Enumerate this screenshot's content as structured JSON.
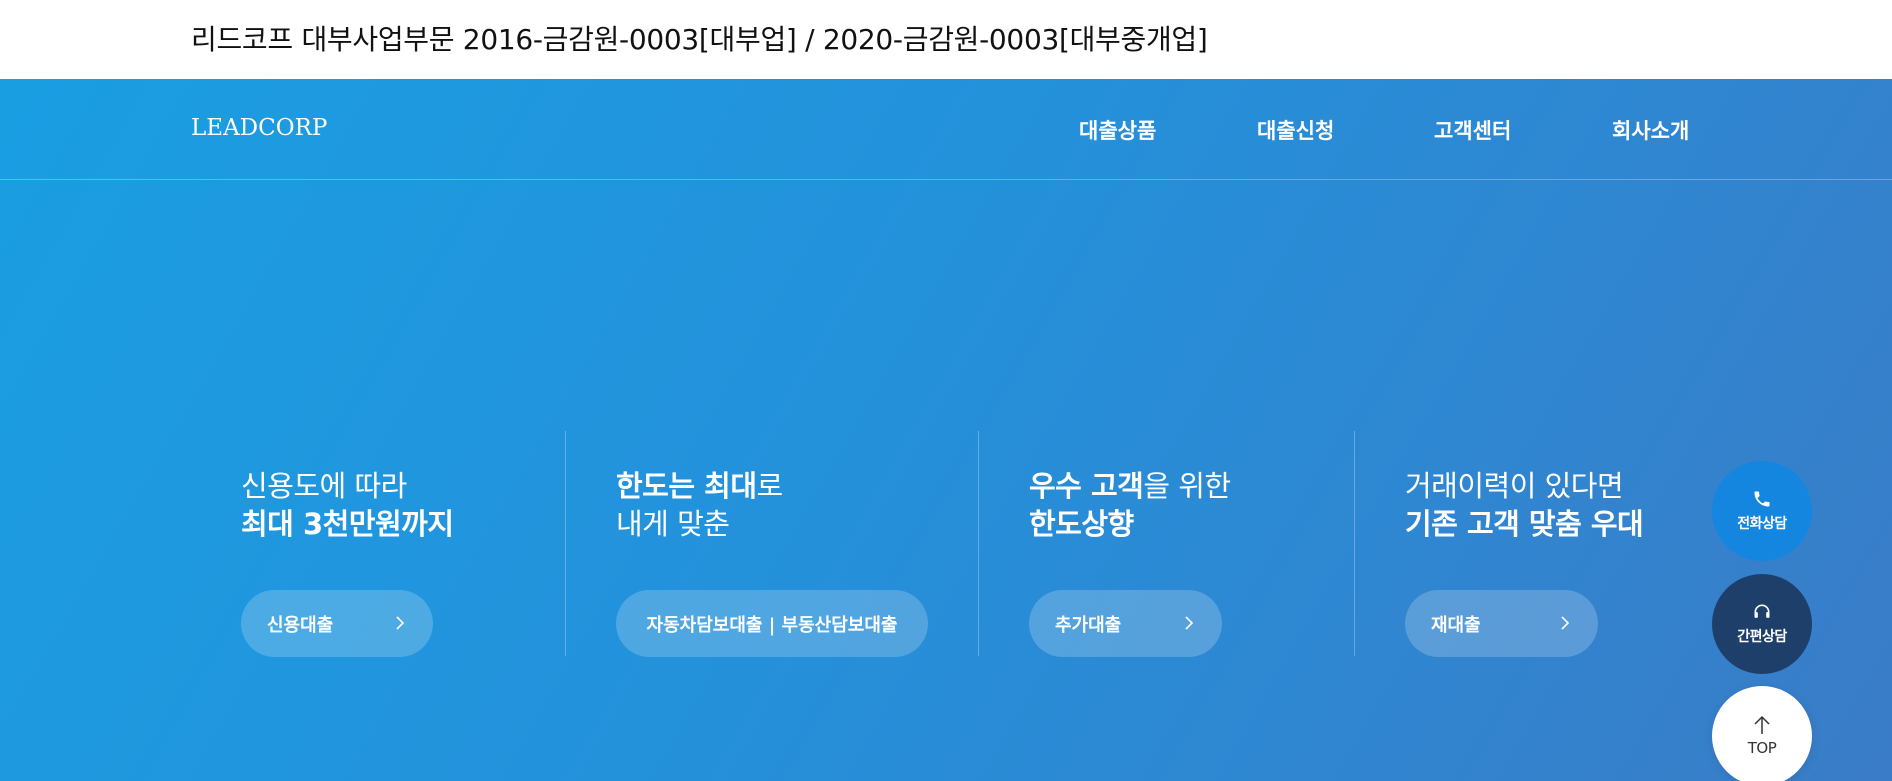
{
  "top_bar": {
    "license_text": "리드코프 대부사업부문 2016-금감원-0003[대부업] / 2020-금감원-0003[대부중개업]"
  },
  "nav": {
    "logo": "LEADCORP",
    "menu": [
      "대출상품",
      "대출신청",
      "고객센터",
      "회사소개"
    ]
  },
  "features": [
    {
      "line1_a": "신용도에 따라",
      "line1_b": "",
      "line2_a": "최대 3천만원까지",
      "line2_b": "",
      "button": "신용대출"
    },
    {
      "line1_a": "한도는 최대",
      "line1_b": "로",
      "line2_a": "",
      "line2_b": "내게 맞춘",
      "button": "자동차담보대출 | 부동산담보대출"
    },
    {
      "line1_a": "우수 고객",
      "line1_b": "을 위한",
      "line2_a": "한도상향",
      "line2_b": "",
      "button": "추가대출"
    },
    {
      "line1_a": "거래이력이 있다면",
      "line1_b": "",
      "line2_a": "기존 고객 맞춤 우대",
      "line2_b": "",
      "button": "재대출"
    }
  ],
  "floating": {
    "call_label": "전화상담",
    "chat_label": "간편상담",
    "top_label": "TOP"
  },
  "icons": [
    "phone-icon",
    "headset-icon",
    "arrow-up-icon",
    "chevron-right-icon"
  ],
  "colors": {
    "hero_start": "#1a9ee2",
    "hero_end": "#3a7cc7",
    "call_button": "#1486e0",
    "chat_button": "#1f3f6b"
  }
}
